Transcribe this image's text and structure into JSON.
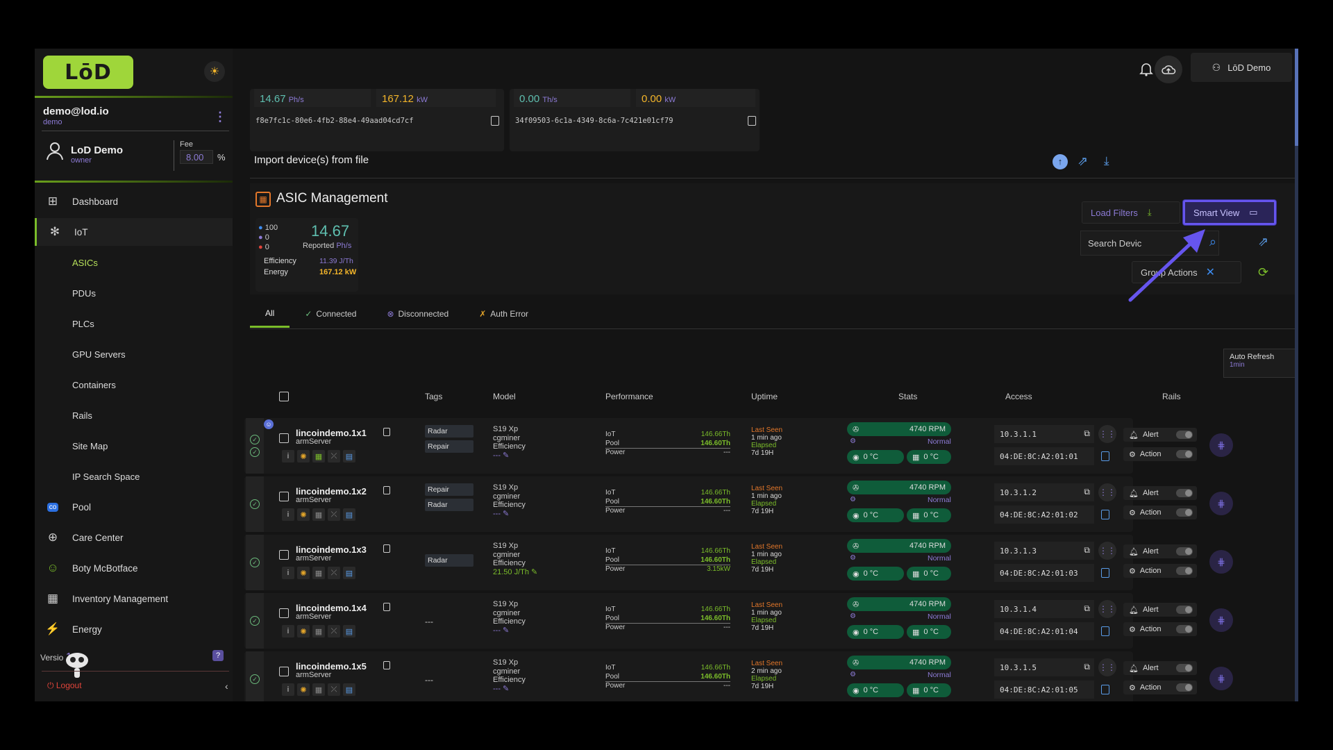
{
  "brand": {
    "logo": "LōD"
  },
  "user": {
    "email": "demo@lod.io",
    "role": "demo"
  },
  "account": {
    "name": "LoD Demo",
    "role": "owner",
    "fee_label": "Fee",
    "fee_value": "8.00",
    "fee_unit": "%"
  },
  "nav": {
    "items": [
      {
        "label": "Dashboard",
        "icon": "dashboard-icon"
      },
      {
        "label": "IoT",
        "icon": "iot-icon"
      },
      {
        "label": "ASICs"
      },
      {
        "label": "PDUs"
      },
      {
        "label": "PLCs"
      },
      {
        "label": "GPU Servers"
      },
      {
        "label": "Containers"
      },
      {
        "label": "Rails"
      },
      {
        "label": "Site Map"
      },
      {
        "label": "IP Search Space"
      },
      {
        "label": "Pool",
        "icon": "pool-icon"
      },
      {
        "label": "Care Center",
        "icon": "care-icon"
      },
      {
        "label": "Boty McBotface",
        "icon": "bot-icon"
      },
      {
        "label": "Inventory Management",
        "icon": "inventory-icon"
      },
      {
        "label": "Energy",
        "icon": "energy-icon"
      }
    ],
    "version_prefix": "Versio",
    "version_suffix": "1.0",
    "logout": "Logout"
  },
  "topbar": {
    "user_button": "LōD Demo"
  },
  "top_cards": [
    {
      "hash": "14.67",
      "hash_unit": "Ph/s",
      "power": "167.12",
      "power_unit": "kW",
      "id": "f8e7fc1c-80e6-4fb2-88e4-49aad04cd7cf"
    },
    {
      "hash": "0.00",
      "hash_unit": "Th/s",
      "power": "0.00",
      "power_unit": "kW",
      "id": "34f09503-6c1a-4349-8c6a-7c421e01cf79"
    }
  ],
  "import": {
    "title": "Import device(s) from file"
  },
  "asic": {
    "title": "ASIC Management",
    "summary": {
      "count_ok": "100",
      "count_mid": "0",
      "count_err": "0",
      "hash": "14.67",
      "reported": "Reported",
      "hash_unit": "Ph/s",
      "eff_label": "Efficiency",
      "eff_value": "11.39 J/Th",
      "energy_label": "Energy",
      "energy_value": "167.12 kW"
    },
    "load_filters": "Load Filters",
    "smart_view": "Smart View",
    "search_placeholder": "Search Devic",
    "group_actions": "Group Actions",
    "tabs": [
      "All",
      "Connected",
      "Disconnected",
      "Auth Error"
    ],
    "auto_refresh_label": "Auto Refresh",
    "auto_refresh_value": "1min",
    "columns": [
      "Tags",
      "Model",
      "Performance",
      "Uptime",
      "Stats",
      "Access",
      "Rails"
    ]
  },
  "devices": [
    {
      "name": "lincoindemo.1x1",
      "server": "armServer",
      "tags": [
        "Radar",
        "Repair"
      ],
      "model": "S19 Xp",
      "miner": "cgminer",
      "eff": "--- ",
      "eff_green": false,
      "iot": "146.66Th",
      "pool": "146.60Th",
      "power": "---",
      "last_seen": "Last Seen",
      "ago": "1 min ago",
      "elapsed": "Elapsed",
      "up": "7d 19H",
      "rpm": "4740 RPM",
      "status": "Normal",
      "t1": "0 °C",
      "t2": "0 °C",
      "ip": "10.3.1.1",
      "mac": "04:DE:8C:A2:01:01"
    },
    {
      "name": "lincoindemo.1x2",
      "server": "armServer",
      "tags": [
        "Repair",
        "Radar"
      ],
      "model": "S19 Xp",
      "miner": "cgminer",
      "eff": "--- ",
      "eff_green": false,
      "iot": "146.66Th",
      "pool": "146.60Th",
      "power": "---",
      "last_seen": "Last Seen",
      "ago": "1 min ago",
      "elapsed": "Elapsed",
      "up": "7d 19H",
      "rpm": "4740 RPM",
      "status": "Normal",
      "t1": "0 °C",
      "t2": "0 °C",
      "ip": "10.3.1.2",
      "mac": "04:DE:8C:A2:01:02"
    },
    {
      "name": "lincoindemo.1x3",
      "server": "armServer",
      "tags": [
        "Radar"
      ],
      "model": "S19 Xp",
      "miner": "cgminer",
      "eff": "21.50 J/Th",
      "eff_green": true,
      "iot": "146.66Th",
      "pool": "146.60Th",
      "power": "3.15kW",
      "last_seen": "Last Seen",
      "ago": "1 min ago",
      "elapsed": "Elapsed",
      "up": "7d 19H",
      "rpm": "4740 RPM",
      "status": "Normal",
      "t1": "0 °C",
      "t2": "0 °C",
      "ip": "10.3.1.3",
      "mac": "04:DE:8C:A2:01:03"
    },
    {
      "name": "lincoindemo.1x4",
      "server": "armServer",
      "tags": [],
      "model": "S19 Xp",
      "miner": "cgminer",
      "eff": "--- ",
      "eff_green": false,
      "iot": "146.66Th",
      "pool": "146.60Th",
      "power": "---",
      "last_seen": "Last Seen",
      "ago": "1 min ago",
      "elapsed": "Elapsed",
      "up": "7d 19H",
      "rpm": "4740 RPM",
      "status": "Normal",
      "t1": "0 °C",
      "t2": "0 °C",
      "ip": "10.3.1.4",
      "mac": "04:DE:8C:A2:01:04"
    },
    {
      "name": "lincoindemo.1x5",
      "server": "armServer",
      "tags": [],
      "model": "S19 Xp",
      "miner": "cgminer",
      "eff": "--- ",
      "eff_green": false,
      "iot": "146.66Th",
      "pool": "146.60Th",
      "power": "---",
      "last_seen": "Last Seen",
      "ago": "2 min ago",
      "elapsed": "Elapsed",
      "up": "7d 19H",
      "rpm": "4740 RPM",
      "status": "Normal",
      "t1": "0 °C",
      "t2": "0 °C",
      "ip": "10.3.1.5",
      "mac": "04:DE:8C:A2:01:05"
    }
  ],
  "row_labels": {
    "iot": "IoT",
    "pool": "Pool",
    "power": "Power",
    "efficiency": "Efficiency",
    "alert": "Alert",
    "action": "Action",
    "no_tags": "---"
  },
  "colors": {
    "accent_green": "#7bbd2a",
    "accent_purple": "#8d7bd6",
    "highlight": "#6655ee",
    "warn_orange": "#e3772a"
  }
}
